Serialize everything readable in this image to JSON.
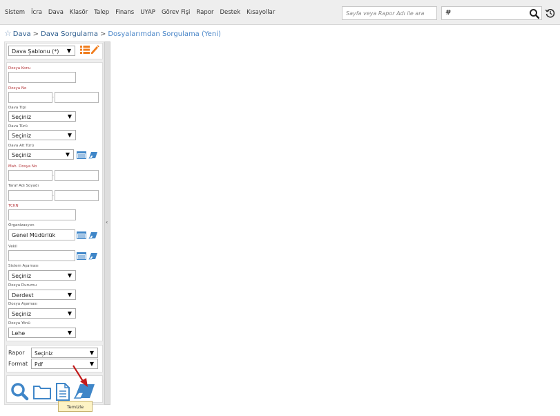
{
  "nav": {
    "items": [
      "Sistem",
      "İcra",
      "Dava",
      "Klasör",
      "Talep",
      "Finans",
      "UYAP",
      "Görev Fişi",
      "Rapor",
      "Destek",
      "Kısayollar"
    ],
    "search_placeholder": "Sayfa veya Rapor Adı ile ara",
    "hash_symbol": "#"
  },
  "breadcrumb": {
    "root": "Dava",
    "parent": "Dava Sorgulama",
    "current": "Dosyalarımdan Sorgulama (Yeni)",
    "separator": ">"
  },
  "template": {
    "value": "Dava Şablonu (*)"
  },
  "form": {
    "dosya_konu_label": "Dosya Konu",
    "dosya_no_label": "Dosya No",
    "dava_tipi_label": "Dava Tipi",
    "dava_tipi_value": "Seçiniz",
    "dava_turu_label": "Dava Türü",
    "dava_turu_value": "Seçiniz",
    "dava_alt_turu_label": "Dava Alt Türü",
    "dava_alt_turu_value": "Seçiniz",
    "mah_dosya_no_label": "Mah. Dosya No",
    "taraf_label": "Taraf Adı Soyadı",
    "tckn_label": "TCKN",
    "organizasyon_label": "Organizasyon",
    "organizasyon_value": "Genel Müdürlük",
    "vekil_label": "Vekil",
    "sistem_asamasi_label": "Sistem Aşaması",
    "sistem_asamasi_value": "Seçiniz",
    "dosya_durumu_label": "Dosya Durumu",
    "dosya_durumu_value": "Derdest",
    "dosya_asamasi_label": "Dosya Aşaması",
    "dosya_asamasi_value": "Seçiniz",
    "dosya_yonu_label": "Dosya Yönü",
    "dosya_yonu_value": "Lehe"
  },
  "report": {
    "rapor_label": "Rapor",
    "rapor_value": "Seçiniz",
    "format_label": "Format",
    "format_value": "Pdf"
  },
  "tooltip": {
    "text": "Temizle"
  },
  "dash_char": "-",
  "caret_char": "▼",
  "collapse_char": "‹",
  "colors": {
    "accent": "#3f86c8",
    "label_red": "#b4363a",
    "orange": "#f07d1e",
    "arrow_red": "#c21a1a",
    "tooltip_bg": "#fdf3c5"
  }
}
